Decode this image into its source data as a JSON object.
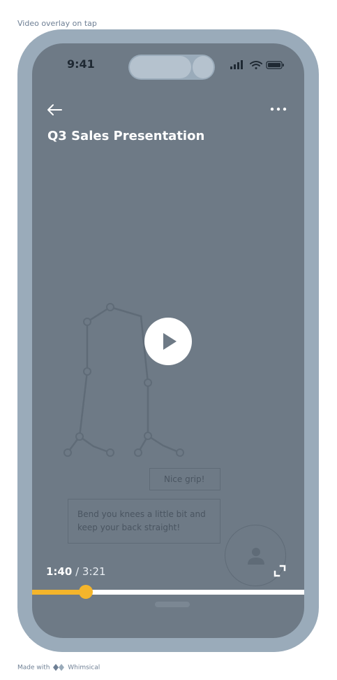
{
  "caption": "Video overlay on tap",
  "status_bar": {
    "time": "9:41"
  },
  "video": {
    "title": "Q3 Sales Presentation",
    "current_time": "1:40",
    "separator": " / ",
    "total_time": "3:21",
    "progress": 0.197
  },
  "comments": [
    {
      "text": "Nice grip!"
    },
    {
      "text": "Bend you knees a little bit and keep your back straight!"
    }
  ],
  "icons": {
    "back": "arrow-left-icon",
    "more": "more-dots-icon",
    "play": "play-icon",
    "fullscreen": "expand-icon",
    "avatar": "user-icon"
  },
  "colors": {
    "screen_bg": "#6e7a86",
    "frame": "#9aabba",
    "accent": "#f4b52b"
  },
  "footer": {
    "prefix": "Made with",
    "brand": "Whimsical"
  }
}
